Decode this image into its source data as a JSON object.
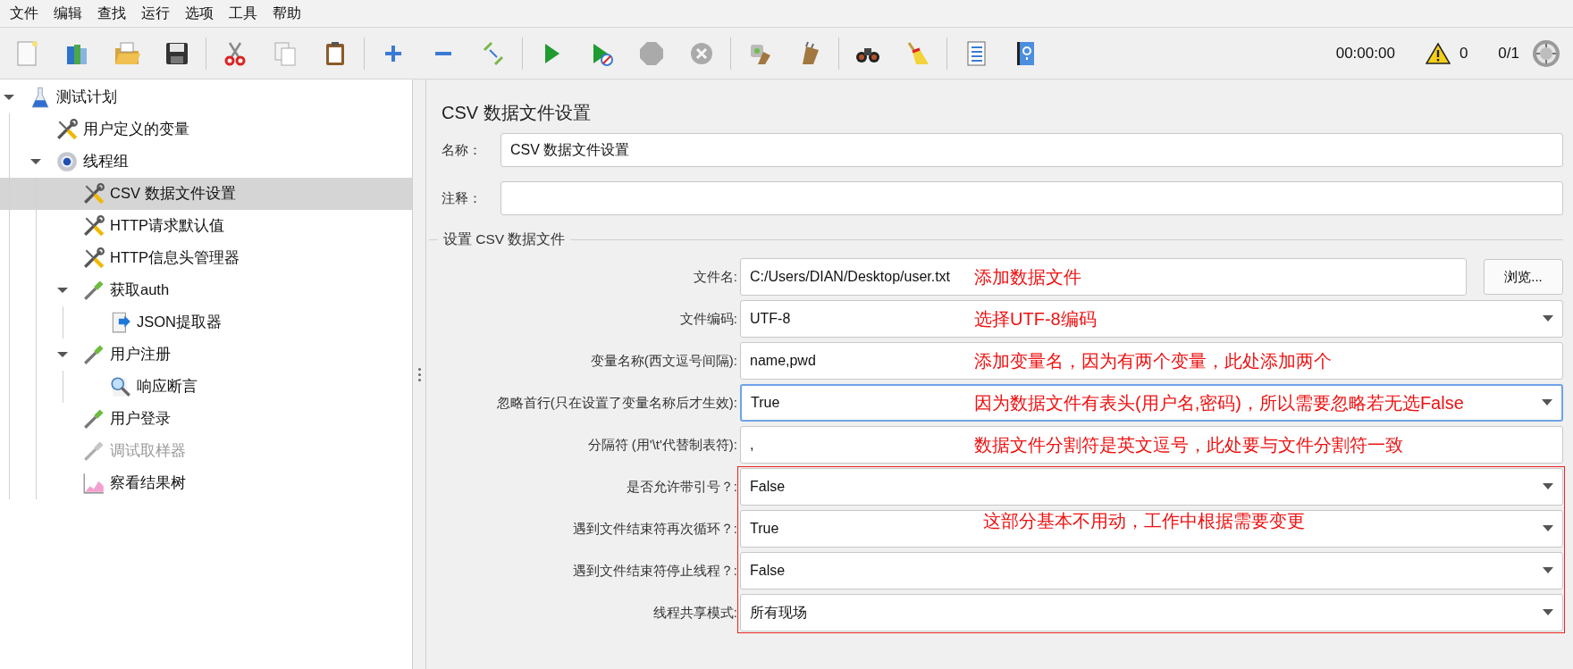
{
  "menu": [
    "文件",
    "编辑",
    "查找",
    "运行",
    "选项",
    "工具",
    "帮助"
  ],
  "toolbar": {
    "groups": [
      [
        {
          "kind": "new",
          "disabled": false
        },
        {
          "kind": "templates",
          "disabled": false
        },
        {
          "kind": "open",
          "disabled": false
        },
        {
          "kind": "save",
          "disabled": false
        }
      ],
      [
        {
          "kind": "cut",
          "disabled": false
        },
        {
          "kind": "copy",
          "disabled": false
        },
        {
          "kind": "paste",
          "disabled": false
        }
      ],
      [
        {
          "kind": "expand",
          "disabled": false
        },
        {
          "kind": "collapse",
          "disabled": false
        },
        {
          "kind": "toggle",
          "disabled": false
        }
      ],
      [
        {
          "kind": "start",
          "disabled": false
        },
        {
          "kind": "start-no-pauses",
          "disabled": false
        },
        {
          "kind": "stop",
          "disabled": true
        },
        {
          "kind": "shutdown",
          "disabled": true
        }
      ],
      [
        {
          "kind": "clear",
          "disabled": false
        },
        {
          "kind": "clear-all",
          "disabled": false
        }
      ],
      [
        {
          "kind": "search",
          "disabled": false
        },
        {
          "kind": "reset-search",
          "disabled": false
        }
      ],
      [
        {
          "kind": "functions",
          "disabled": false
        },
        {
          "kind": "help",
          "disabled": false
        }
      ]
    ],
    "timer": "00:00:00",
    "warnings": "0",
    "threads": "0/1"
  },
  "tree": [
    {
      "label": "测试计划",
      "kind": "plan",
      "expanded": true,
      "selected": false,
      "disabled": false,
      "children": [
        {
          "label": "用户定义的变量",
          "kind": "config",
          "selected": false,
          "disabled": false
        },
        {
          "label": "线程组",
          "kind": "threadgroup",
          "expanded": true,
          "selected": false,
          "disabled": false,
          "children": [
            {
              "label": "CSV 数据文件设置",
              "kind": "config",
              "selected": true,
              "disabled": false
            },
            {
              "label": "HTTP请求默认值",
              "kind": "config",
              "selected": false,
              "disabled": false
            },
            {
              "label": "HTTP信息头管理器",
              "kind": "config",
              "selected": false,
              "disabled": false
            },
            {
              "label": "获取auth",
              "kind": "sampler",
              "expanded": true,
              "selected": false,
              "disabled": false,
              "children": [
                {
                  "label": "JSON提取器",
                  "kind": "extractor",
                  "selected": false,
                  "disabled": false
                }
              ]
            },
            {
              "label": "用户注册",
              "kind": "sampler",
              "expanded": true,
              "selected": false,
              "disabled": false,
              "children": [
                {
                  "label": "响应断言",
                  "kind": "assertion",
                  "selected": false,
                  "disabled": false
                }
              ]
            },
            {
              "label": "用户登录",
              "kind": "sampler",
              "selected": false,
              "disabled": false
            },
            {
              "label": "调试取样器",
              "kind": "sampler",
              "selected": false,
              "disabled": true
            },
            {
              "label": "察看结果树",
              "kind": "listener",
              "selected": false,
              "disabled": false
            }
          ]
        }
      ]
    }
  ],
  "panel": {
    "title": "CSV 数据文件设置",
    "name": {
      "label": "名称：",
      "value": "CSV 数据文件设置"
    },
    "comment": {
      "label": "注释："
    },
    "section": {
      "title": "设置 CSV 数据文件",
      "rows": [
        {
          "kind": "text",
          "label": "文件名:",
          "value": "C:/Users/DIAN/Desktop/user.txt",
          "button": "浏览...",
          "focused": false,
          "note": "添加数据文件"
        },
        {
          "kind": "select",
          "label": "文件编码:",
          "value": "UTF-8",
          "focused": false,
          "note": "选择UTF-8编码"
        },
        {
          "kind": "text",
          "label": "变量名称(西文逗号间隔):",
          "value": "name,pwd",
          "focused": false,
          "note": "添加变量名，因为有两个变量，此处添加两个"
        },
        {
          "kind": "select",
          "label": "忽略首行(只在设置了变量名称后才生效):",
          "value": "True",
          "focused": true,
          "note": "因为数据文件有表头(用户名,密码)，所以需要忽略若无选False"
        },
        {
          "kind": "text",
          "label": "分隔符 (用'\\t'代替制表符):",
          "value": ",",
          "focused": false,
          "note": "数据文件分割符是英文逗号，此处要与文件分割符一致"
        }
      ],
      "boxed": {
        "note": "这部分基本不用动，工作中根据需要变更",
        "rows": [
          {
            "kind": "select",
            "label": "是否允许带引号？:",
            "value": "False",
            "focused": false
          },
          {
            "kind": "select",
            "label": "遇到文件结束符再次循环？:",
            "value": "True",
            "focused": false
          },
          {
            "kind": "select",
            "label": "遇到文件结束符停止线程？:",
            "value": "False",
            "focused": false
          },
          {
            "kind": "select",
            "label": "线程共享模式:",
            "value": "所有现场",
            "focused": false
          }
        ]
      }
    }
  }
}
